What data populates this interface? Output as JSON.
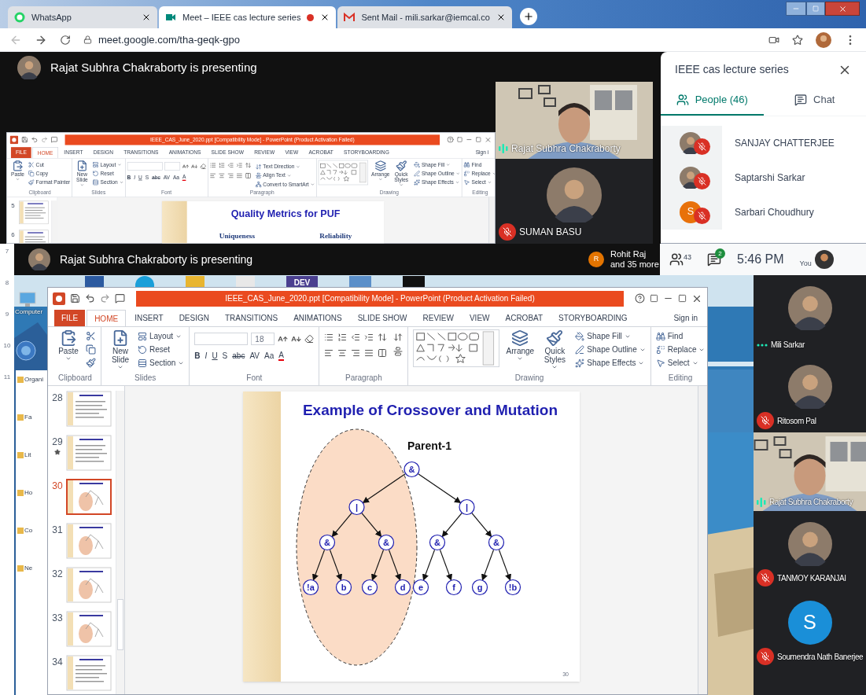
{
  "browser": {
    "tabs": [
      {
        "title": "WhatsApp",
        "kind": "whatsapp",
        "selected": false,
        "recording": false
      },
      {
        "title": "Meet – IEEE cas lecture series",
        "kind": "meet",
        "selected": true,
        "recording": true
      },
      {
        "title": "Sent Mail - mili.sarkar@iemcal.co",
        "kind": "gmail",
        "selected": false,
        "recording": false
      }
    ],
    "url": "meet.google.com/tha-geqk-gpo"
  },
  "meet_top": {
    "presenter_banner": "Rajat Subhra Chakraborty is presenting",
    "powerpoint": {
      "title": "IEEE_CAS_June_2020.ppt [Compatibility Mode] - PowerPoint (Product Activation Failed)",
      "tabs": [
        {
          "label": "FILE",
          "kind": "file",
          "selected": false
        },
        {
          "label": "HOME",
          "kind": "tab",
          "selected": true
        },
        {
          "label": "INSERT",
          "kind": "tab",
          "selected": false
        },
        {
          "label": "DESIGN",
          "kind": "tab",
          "selected": false
        },
        {
          "label": "TRANSITIONS",
          "kind": "tab",
          "selected": false
        },
        {
          "label": "ANIMATIONS",
          "kind": "tab",
          "selected": false
        },
        {
          "label": "SLIDE SHOW",
          "kind": "tab",
          "selected": false
        },
        {
          "label": "REVIEW",
          "kind": "tab",
          "selected": false
        },
        {
          "label": "VIEW",
          "kind": "tab",
          "selected": false
        },
        {
          "label": "ACROBAT",
          "kind": "tab",
          "selected": false
        },
        {
          "label": "STORYBOARDING",
          "kind": "tab",
          "selected": false
        }
      ],
      "sign_in": "Sign i",
      "groups": [
        {
          "kind": "clipboard",
          "label": "Clipboard",
          "large": "Paste",
          "small": [
            "Cut",
            "Copy",
            "Format Painter"
          ]
        },
        {
          "kind": "slides",
          "label": "Slides",
          "large": "New Slide",
          "small": [
            "Layout",
            "Reset",
            "Section"
          ]
        },
        {
          "kind": "font",
          "label": "Font",
          "buttons": [
            "B",
            "I",
            "U",
            "S",
            "abc",
            "AV",
            "Aa",
            "A"
          ]
        },
        {
          "kind": "paragraph",
          "label": "Paragraph",
          "small": [
            "Text Direction",
            "Align Text",
            "Convert to SmartArt"
          ]
        },
        {
          "kind": "drawing",
          "label": "Drawing",
          "large": [
            "Arrange",
            "Quick Styles"
          ],
          "small": [
            "Shape Fill",
            "Shape Outline",
            "Shape Effects"
          ]
        },
        {
          "kind": "editing",
          "label": "Editing",
          "small": [
            "Find",
            "Replace",
            "Select"
          ]
        }
      ],
      "thumbnails": [
        {
          "number": "5",
          "selected": false,
          "starred": false
        },
        {
          "number": "6",
          "selected": false,
          "starred": false
        }
      ],
      "slide": {
        "kind": "columns",
        "title": "Quality Metrics for PUF",
        "columns": [
          "Uniqueness",
          "Reliability"
        ]
      }
    },
    "tiles": [
      {
        "name": "Rajat Subhra Chakraborty",
        "kind": "video",
        "muted": false,
        "speaking": true
      },
      {
        "name": "SUMAN BASU",
        "muted": true,
        "speaking": false
      }
    ],
    "side_panel": {
      "title": "IEEE cas lecture series",
      "tabs": [
        {
          "label": "People (46)",
          "kind": "people",
          "selected": true
        },
        {
          "label": "Chat",
          "kind": "chat",
          "selected": false
        }
      ],
      "people": [
        {
          "name": "SANJAY CHATTERJEE",
          "muted": true
        },
        {
          "name": "Saptarshi Sarkar",
          "muted": true
        },
        {
          "name": "Sarbari Choudhury",
          "kind": "letter",
          "letter": "S",
          "color": "#e8710a",
          "muted": true
        }
      ]
    }
  },
  "left_edge_slide_numbers": [
    "7",
    "8",
    "9",
    "10",
    "11"
  ],
  "meet_bottom": {
    "presenter_banner": "Rajat Subhra Chakraborty is presenting",
    "others": {
      "kind": "letter",
      "letter": "R",
      "color": "#e37400",
      "name": "Rohit Raj",
      "more": "and 35 more"
    },
    "people_count": "43",
    "chat_badge": "2",
    "time": "5:46 PM",
    "self_label": "You",
    "desktop": {
      "icon_text": "DEV",
      "icon_label": "Computer",
      "explorer_items": [
        "Organi",
        "Fa",
        "Lit",
        "Ho",
        "Co",
        "Ne"
      ]
    },
    "powerpoint": {
      "title": "IEEE_CAS_June_2020.ppt [Compatibility Mode] - PowerPoint (Product Activation Failed)",
      "tabs": [
        {
          "label": "FILE",
          "kind": "file",
          "selected": false
        },
        {
          "label": "HOME",
          "kind": "tab",
          "selected": true
        },
        {
          "label": "INSERT",
          "kind": "tab",
          "selected": false
        },
        {
          "label": "DESIGN",
          "kind": "tab",
          "selected": false
        },
        {
          "label": "TRANSITIONS",
          "kind": "tab",
          "selected": false
        },
        {
          "label": "ANIMATIONS",
          "kind": "tab",
          "selected": false
        },
        {
          "label": "SLIDE SHOW",
          "kind": "tab",
          "selected": false
        },
        {
          "label": "REVIEW",
          "kind": "tab",
          "selected": false
        },
        {
          "label": "VIEW",
          "kind": "tab",
          "selected": false
        },
        {
          "label": "ACROBAT",
          "kind": "tab",
          "selected": false
        },
        {
          "label": "STORYBOARDING",
          "kind": "tab",
          "selected": false
        }
      ],
      "sign_in": "Sign in",
      "groups": [
        {
          "kind": "clipboard",
          "label": "Clipboard",
          "large": "Paste"
        },
        {
          "kind": "slides",
          "label": "Slides",
          "large": "New Slide",
          "small": [
            "Layout",
            "Reset",
            "Section"
          ]
        },
        {
          "kind": "font",
          "label": "Font",
          "size": "18",
          "buttons": [
            "B",
            "I",
            "U",
            "S",
            "abc",
            "AV",
            "Aa",
            "A"
          ]
        },
        {
          "kind": "paragraph",
          "label": "Paragraph"
        },
        {
          "kind": "drawing",
          "label": "Drawing",
          "large": [
            "Arrange",
            "Quick Styles"
          ],
          "small": [
            "Shape Fill",
            "Shape Outline",
            "Shape Effects"
          ]
        },
        {
          "kind": "editing",
          "label": "Editing",
          "small": [
            "Find",
            "Replace",
            "Select"
          ]
        }
      ],
      "thumbnails": [
        {
          "number": "28",
          "kind": "text",
          "selected": false,
          "starred": false
        },
        {
          "number": "29",
          "kind": "text",
          "selected": false,
          "starred": true
        },
        {
          "number": "30",
          "kind": "tree",
          "selected": true,
          "starred": false
        },
        {
          "number": "31",
          "kind": "tree",
          "selected": false,
          "starred": false
        },
        {
          "number": "32",
          "kind": "tree",
          "selected": false,
          "starred": false
        },
        {
          "number": "33",
          "kind": "tree",
          "selected": false,
          "starred": false
        },
        {
          "number": "34",
          "kind": "text",
          "selected": false,
          "starred": false
        }
      ],
      "slide": {
        "kind": "tree",
        "title": "Example of Crossover and Mutation",
        "subtitle": "Parent-1",
        "slide_number": "30",
        "tree": {
          "label": "&",
          "highlighted": false,
          "children": [
            {
              "label": "|",
              "highlighted": true,
              "children": [
                {
                  "label": "&",
                  "highlighted": false,
                  "children": [
                    {
                      "label": "!a",
                      "highlighted": false
                    },
                    {
                      "label": "b",
                      "highlighted": false
                    }
                  ]
                },
                {
                  "label": "&",
                  "highlighted": false,
                  "children": [
                    {
                      "label": "c",
                      "highlighted": false
                    },
                    {
                      "label": "d",
                      "highlighted": false
                    }
                  ]
                }
              ]
            },
            {
              "label": "|",
              "highlighted": false,
              "children": [
                {
                  "label": "&",
                  "highlighted": false,
                  "children": [
                    {
                      "label": "e",
                      "highlighted": false
                    },
                    {
                      "label": "f",
                      "highlighted": false
                    }
                  ]
                },
                {
                  "label": "&",
                  "highlighted": false,
                  "children": [
                    {
                      "label": "g",
                      "highlighted": false
                    },
                    {
                      "label": "!b",
                      "highlighted": false
                    }
                  ]
                }
              ]
            }
          ]
        }
      }
    },
    "tiles": [
      {
        "name": "Mili Sarkar",
        "muted": false,
        "speaking": false
      },
      {
        "name": "Ritosom Pal",
        "muted": true,
        "speaking": false
      },
      {
        "name": "Rajat Subhra Chakraborty",
        "kind": "video",
        "muted": false,
        "speaking": true
      },
      {
        "name": "TANMOY KARANJAI",
        "muted": true,
        "speaking": false
      },
      {
        "name": "Soumendra Nath Banerjee",
        "kind": "letter",
        "letter": "S",
        "color": "#1a8fd8",
        "muted": true,
        "speaking": false
      }
    ]
  }
}
